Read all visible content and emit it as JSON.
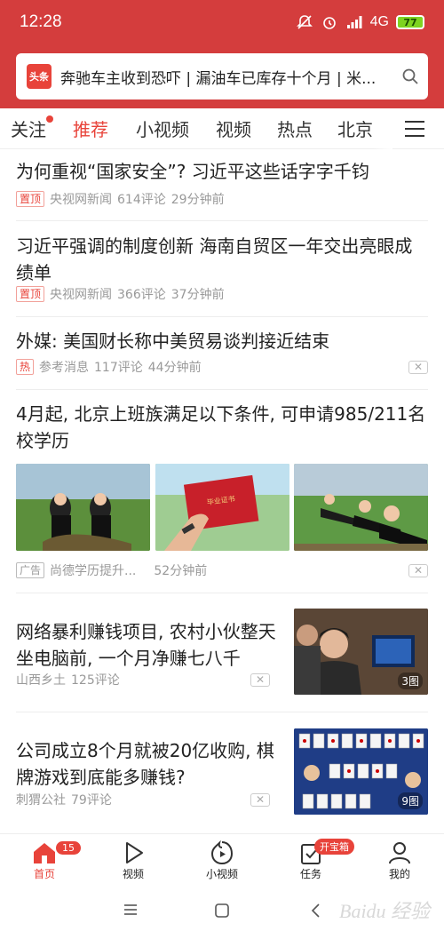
{
  "status": {
    "time": "12:28",
    "network": "4G",
    "battery": "77"
  },
  "search": {
    "logo": "头条",
    "query": "奔驰车主收到恐吓 | 漏油车已库存十个月 | 米..."
  },
  "tabs": [
    {
      "label": "关注",
      "has_dot": true
    },
    {
      "label": "推荐",
      "active": true
    },
    {
      "label": "小视频"
    },
    {
      "label": "视频"
    },
    {
      "label": "热点"
    },
    {
      "label": "北京"
    }
  ],
  "feed": {
    "item1": {
      "title": "为何重视“国家安全”? 习近平这些话字字千钧",
      "tag": "置顶",
      "source": "央视网新闻",
      "comments": "614评论",
      "time": "29分钟前"
    },
    "item2": {
      "title": "习近平强调的制度创新 海南自贸区一年交出亮眼成绩单",
      "tag": "置顶",
      "source": "央视网新闻",
      "comments": "366评论",
      "time": "37分钟前"
    },
    "item3": {
      "title": "外媒: 美国财长称中美贸易谈判接近结束",
      "tag": "热",
      "source": "参考消息",
      "comments": "117评论",
      "time": "44分钟前"
    },
    "item4": {
      "title": "4月起, 北京上班族满足以下条件, 可申请985/211名校学历",
      "tag": "广告",
      "source": "尚德学历提升...",
      "time": "52分钟前",
      "certificate_text": "毕业证书"
    },
    "item5": {
      "title": "网络暴利赚钱项目, 农村小伙整天坐电脑前, 一个月净赚七八千",
      "source": "山西乡土",
      "comments": "125评论",
      "image_count": "3图"
    },
    "item6": {
      "title": "公司成立8个月就被20亿收购, 棋牌游戏到底能多赚钱?",
      "source": "刺猬公社",
      "comments": "79评论",
      "image_count": "9图"
    }
  },
  "close_symbol": "✕",
  "bottom_nav": {
    "home": "首页",
    "video": "视频",
    "small_video": "小视频",
    "task": "任务",
    "mine": "我的",
    "home_badge": "15",
    "task_badge": "开宝箱"
  },
  "watermark": "Baidu 经验",
  "colors": {
    "brand_red": "#d43d3d",
    "accent": "#e8433a"
  }
}
